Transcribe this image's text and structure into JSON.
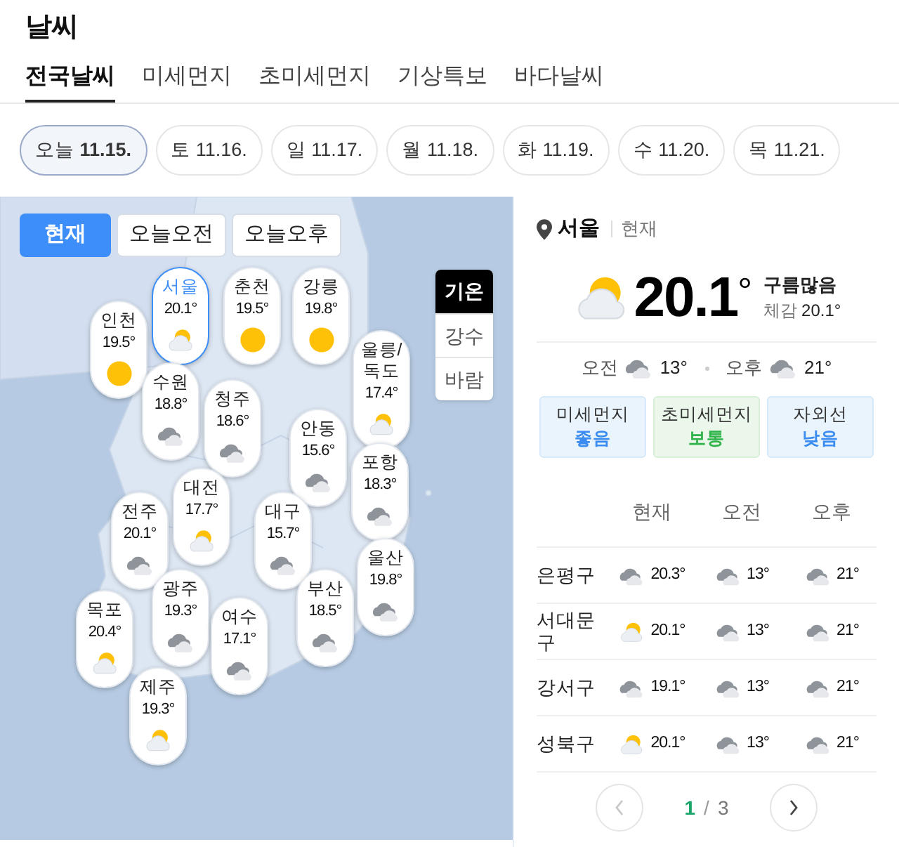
{
  "header": {
    "title": "날씨"
  },
  "tabs": [
    {
      "label": "전국날씨",
      "selected": true
    },
    {
      "label": "미세먼지",
      "selected": false
    },
    {
      "label": "초미세먼지",
      "selected": false
    },
    {
      "label": "기상특보",
      "selected": false
    },
    {
      "label": "바다날씨",
      "selected": false
    }
  ],
  "dates": [
    {
      "day": "오늘",
      "date": "11.15.",
      "selected": true
    },
    {
      "day": "토",
      "date": "11.16.",
      "selected": false
    },
    {
      "day": "일",
      "date": "11.17.",
      "selected": false
    },
    {
      "day": "월",
      "date": "11.18.",
      "selected": false
    },
    {
      "day": "화",
      "date": "11.19.",
      "selected": false
    },
    {
      "day": "수",
      "date": "11.20.",
      "selected": false
    },
    {
      "day": "목",
      "date": "11.21.",
      "selected": false
    }
  ],
  "time_buttons": [
    {
      "label": "현재",
      "selected": true
    },
    {
      "label": "오늘오전",
      "selected": false
    },
    {
      "label": "오늘오후",
      "selected": false
    }
  ],
  "layers": [
    {
      "label": "기온",
      "selected": true
    },
    {
      "label": "강수",
      "selected": false
    },
    {
      "label": "바람",
      "selected": false
    }
  ],
  "cities": [
    {
      "name": "서울",
      "temp": "20.1°",
      "kind": "partly",
      "selected": true
    },
    {
      "name": "춘천",
      "temp": "19.5°",
      "kind": "sunny",
      "selected": false
    },
    {
      "name": "강릉",
      "temp": "19.8°",
      "kind": "sunny",
      "selected": false
    },
    {
      "name": "인천",
      "temp": "19.5°",
      "kind": "sunny",
      "selected": false
    },
    {
      "name": "울릉/독도",
      "temp": "17.4°",
      "kind": "partly",
      "selected": false
    },
    {
      "name": "수원",
      "temp": "18.8°",
      "kind": "cloudy",
      "selected": false
    },
    {
      "name": "청주",
      "temp": "18.6°",
      "kind": "cloudy",
      "selected": false
    },
    {
      "name": "안동",
      "temp": "15.6°",
      "kind": "cloudy",
      "selected": false
    },
    {
      "name": "포항",
      "temp": "18.3°",
      "kind": "cloudy",
      "selected": false
    },
    {
      "name": "대전",
      "temp": "17.7°",
      "kind": "partly",
      "selected": false
    },
    {
      "name": "전주",
      "temp": "20.1°",
      "kind": "cloudy",
      "selected": false
    },
    {
      "name": "대구",
      "temp": "15.7°",
      "kind": "cloudy",
      "selected": false
    },
    {
      "name": "울산",
      "temp": "19.8°",
      "kind": "cloudy",
      "selected": false
    },
    {
      "name": "광주",
      "temp": "19.3°",
      "kind": "cloudy",
      "selected": false
    },
    {
      "name": "부산",
      "temp": "18.5°",
      "kind": "cloudy",
      "selected": false
    },
    {
      "name": "목포",
      "temp": "20.4°",
      "kind": "partly",
      "selected": false
    },
    {
      "name": "여수",
      "temp": "17.1°",
      "kind": "cloudy",
      "selected": false
    },
    {
      "name": "제주",
      "temp": "19.3°",
      "kind": "partly",
      "selected": false
    }
  ],
  "detail": {
    "location": "서울",
    "time": "현재",
    "current": {
      "kind": "partly",
      "temp": "20.1",
      "degree": "°",
      "condition": "구름많음",
      "feels_label": "체감",
      "feels": "20.1°"
    },
    "forecast": [
      {
        "label": "오전",
        "kind": "cloudy",
        "temp": "13°"
      },
      {
        "label": "오후",
        "kind": "cloudy",
        "temp": "21°"
      }
    ],
    "air": [
      {
        "label": "미세먼지",
        "value": "좋음",
        "color": "#3b8cf0"
      },
      {
        "label": "초미세먼지",
        "value": "보통",
        "color": "#2fb34a"
      },
      {
        "label": "자외선",
        "value": "낮음",
        "color": "#3b8cf0"
      }
    ]
  },
  "table": {
    "columns": [
      "현재",
      "오전",
      "오후"
    ],
    "rows": [
      {
        "district": "은평구",
        "cells": [
          {
            "kind": "cloudy",
            "temp": "20.3°"
          },
          {
            "kind": "cloudy",
            "temp": "13°"
          },
          {
            "kind": "cloudy",
            "temp": "21°"
          }
        ]
      },
      {
        "district": "서대문구",
        "cells": [
          {
            "kind": "partly",
            "temp": "20.1°"
          },
          {
            "kind": "cloudy",
            "temp": "13°"
          },
          {
            "kind": "cloudy",
            "temp": "21°"
          }
        ]
      },
      {
        "district": "강서구",
        "cells": [
          {
            "kind": "cloudy",
            "temp": "19.1°"
          },
          {
            "kind": "cloudy",
            "temp": "13°"
          },
          {
            "kind": "cloudy",
            "temp": "21°"
          }
        ]
      },
      {
        "district": "성북구",
        "cells": [
          {
            "kind": "partly",
            "temp": "20.1°"
          },
          {
            "kind": "cloudy",
            "temp": "13°"
          },
          {
            "kind": "cloudy",
            "temp": "21°"
          }
        ]
      }
    ]
  },
  "pagination": {
    "current": "1",
    "separator": "/",
    "total": "3"
  }
}
